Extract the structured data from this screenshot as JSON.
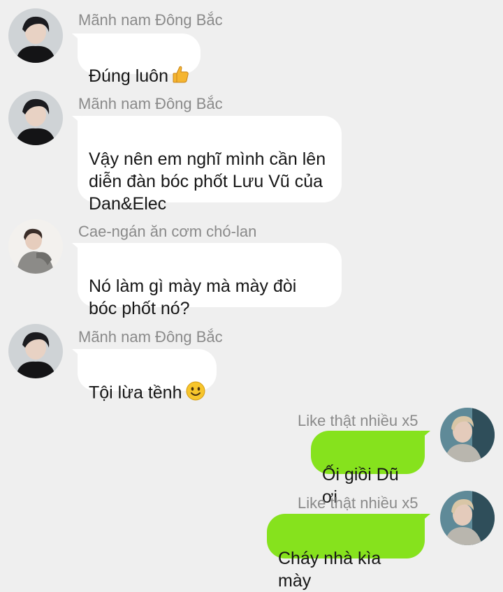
{
  "messages": [
    {
      "sender": "Mãnh nam Đông Bắc",
      "text": "Đúng luôn",
      "emoji": "thumbs-up-icon",
      "side": "left"
    },
    {
      "sender": "Mãnh nam Đông Bắc",
      "text": "Vậy nên em nghĩ mình cần lên\ndiễn đàn bóc phốt Lưu Vũ của\nDan&Elec",
      "side": "left"
    },
    {
      "sender": "Cae-ngán ăn cơm chó-lan",
      "text": "Nó làm gì mày mà mày đòi\nbóc phốt nó?",
      "side": "left"
    },
    {
      "sender": "Mãnh nam Đông Bắc",
      "text": "Tội lừa tềnh",
      "emoji": "smiley-icon",
      "side": "left"
    },
    {
      "sender": "Like thật nhiều x5",
      "text": "Ối giồi Dũ ơi",
      "side": "right"
    },
    {
      "sender": "Like thật nhiều x5",
      "text": "Cháy nhà kìa mày",
      "side": "right"
    }
  ],
  "colors": {
    "background": "#efefef",
    "incoming_bubble": "#ffffff",
    "outgoing_bubble": "#86e21d",
    "sender_name": "#8a8a8a"
  }
}
